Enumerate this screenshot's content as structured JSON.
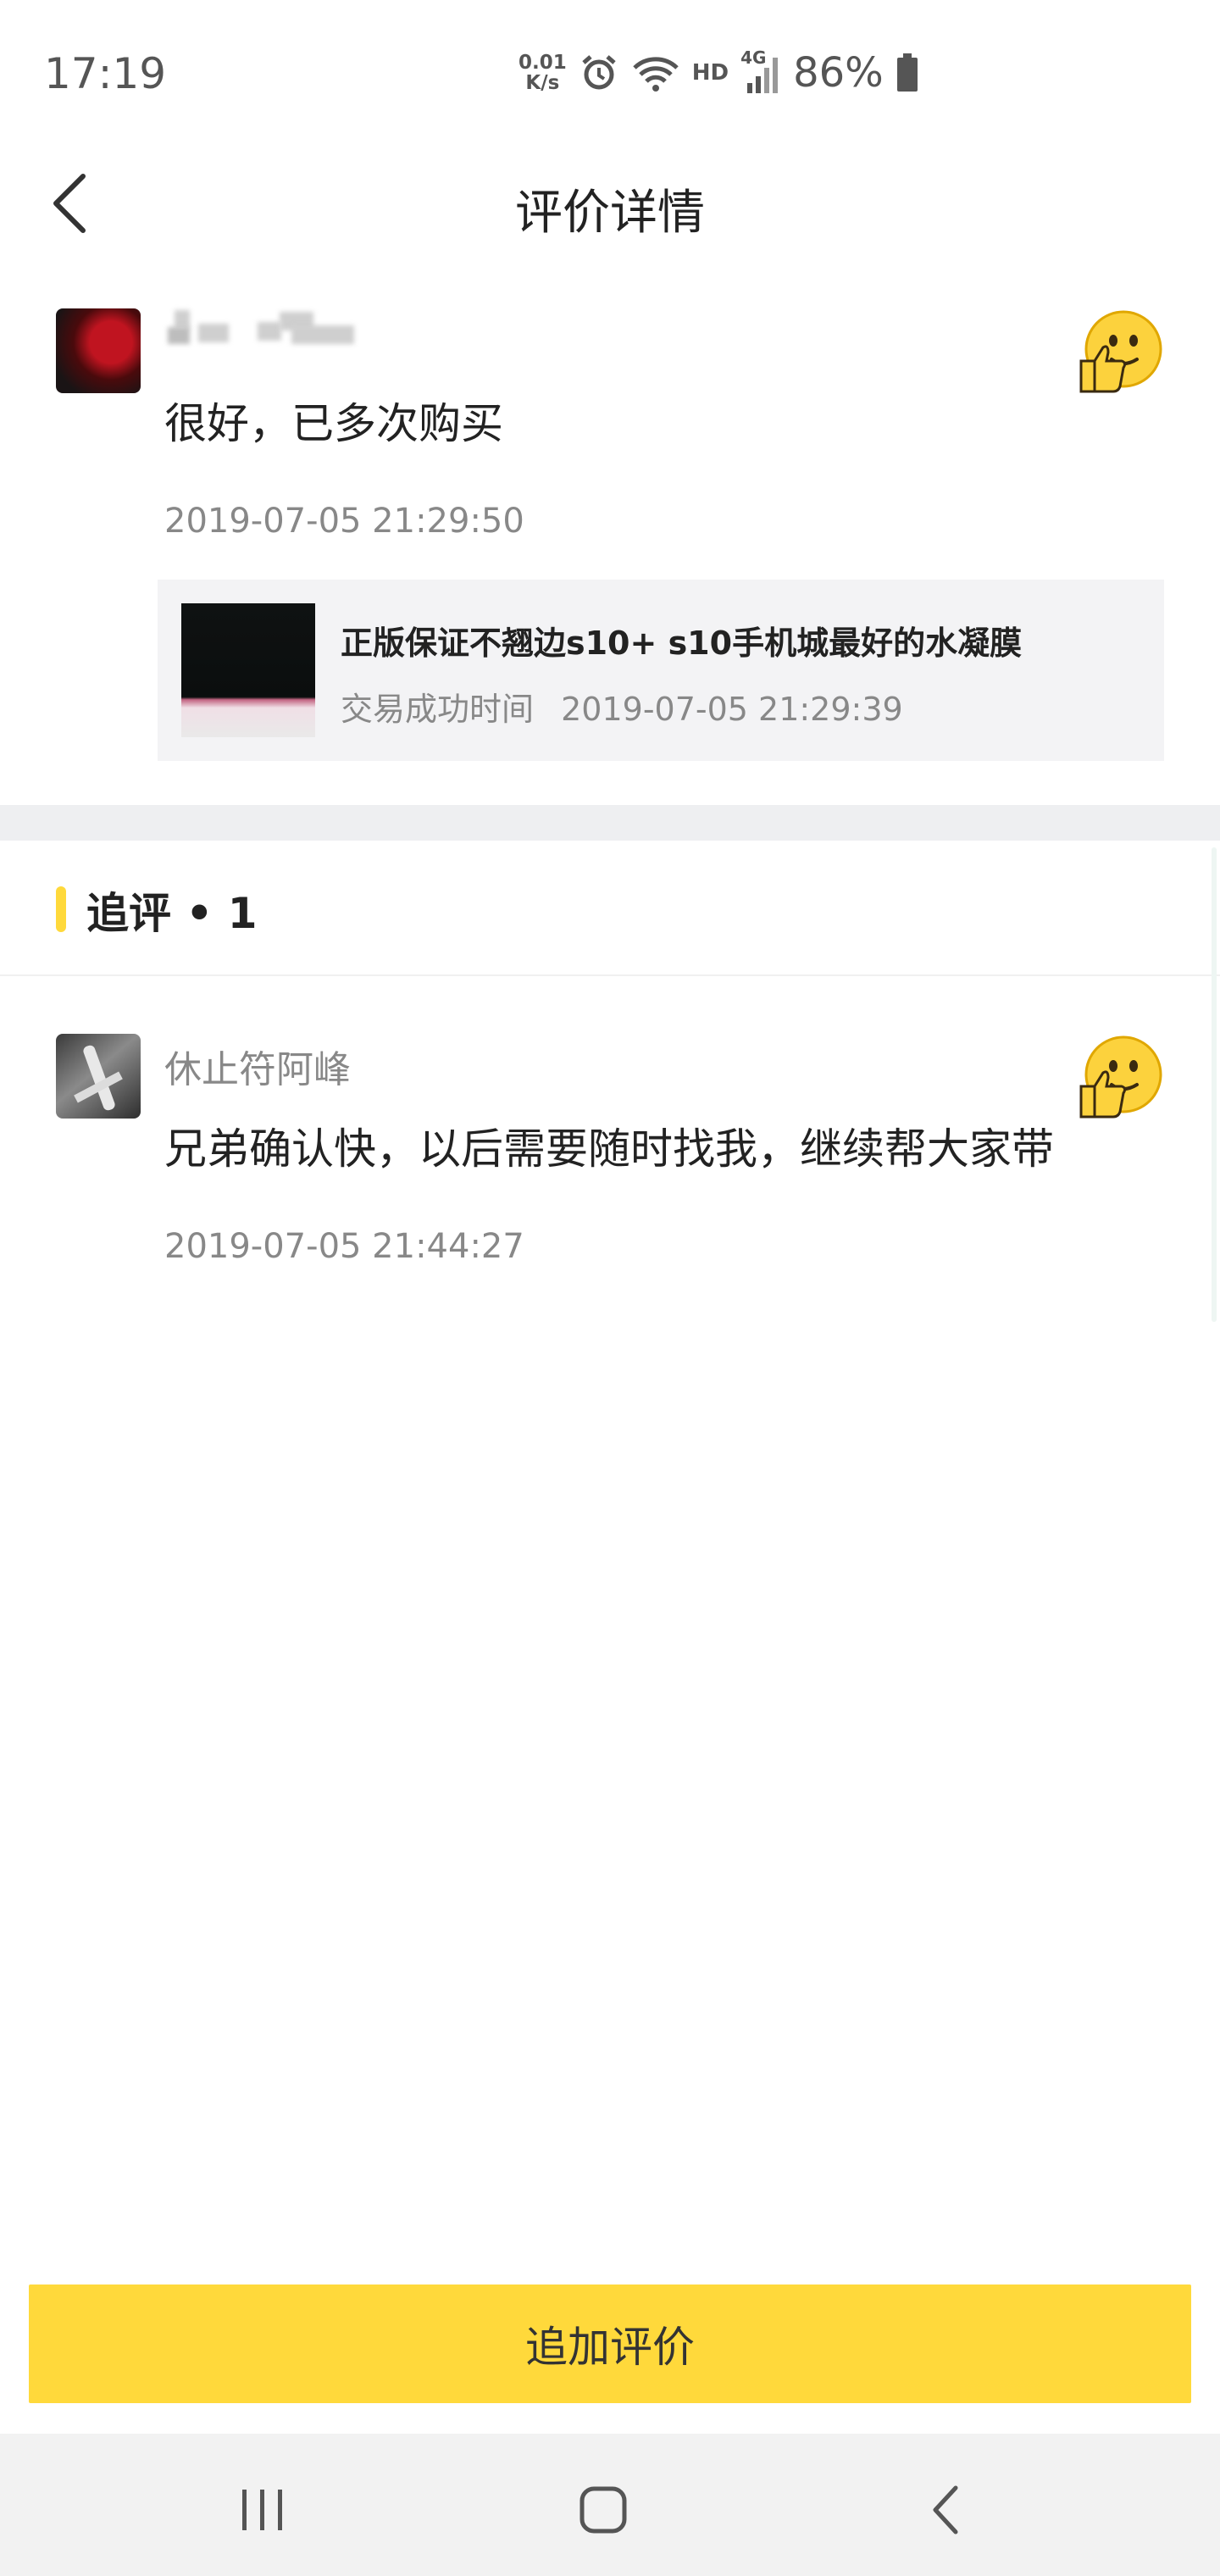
{
  "status_bar": {
    "time": "17:19",
    "net_speed_value": "0.01",
    "net_speed_unit": "K/s",
    "hd_label": "HD",
    "network_type": "4G",
    "battery_percent": "86%"
  },
  "header": {
    "title": "评价详情"
  },
  "review": {
    "text": "很好，已多次购买",
    "date": "2019-07-05 21:29:50"
  },
  "product": {
    "title": "正版保证不翘边s10+ s10手机城最好的水凝膜",
    "time_label": "交易成功时间",
    "time_value": "2019-07-05 21:29:39"
  },
  "followup": {
    "section_title": "追评 • 1",
    "reviewer_name": "休止符阿峰",
    "text": "兄弟确认快，以后需要随时找我，继续帮大家带",
    "date": "2019-07-05 21:44:27"
  },
  "bottom_button": {
    "label": "追加评价"
  },
  "colors": {
    "accent_yellow": "#ffd93b",
    "section_bg": "#eeeff1",
    "card_bg": "#f3f3f5",
    "muted_text": "#888888"
  },
  "icons": [
    "alarm-icon",
    "wifi-icon",
    "signal-icon",
    "battery-icon",
    "back-arrow-icon",
    "thumbs-up-emoji-icon",
    "recent-apps-icon",
    "home-icon",
    "nav-back-icon"
  ]
}
